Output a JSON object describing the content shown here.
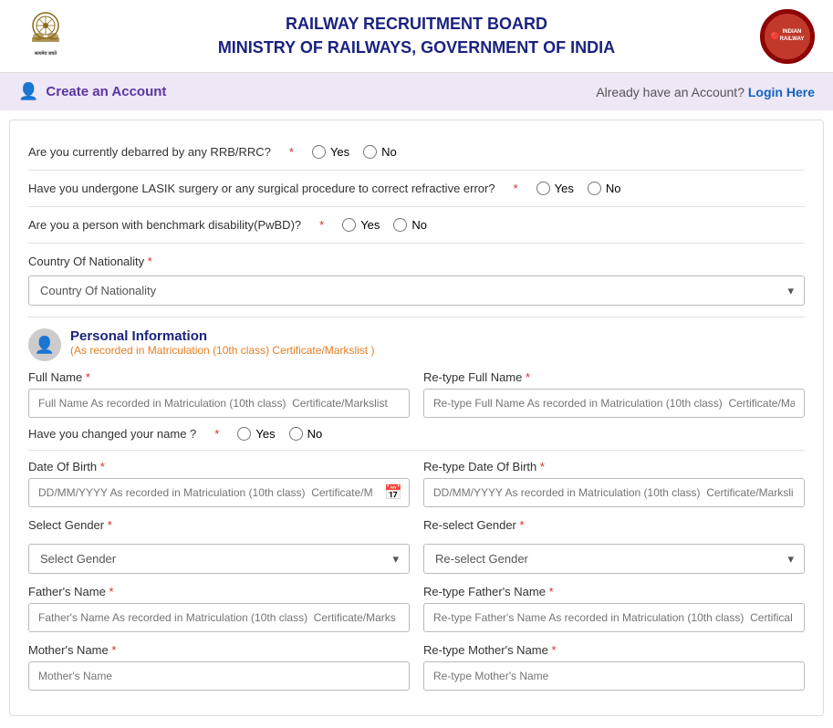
{
  "header": {
    "title_line1": "RAILWAY RECRUITMENT BOARD",
    "title_line2": "MINISTRY OF RAILWAYS, GOVERNMENT OF INDIA",
    "rrb_logo_text": "INDIAN\nRAILWAY"
  },
  "account_bar": {
    "create_account_label": "Create an Account",
    "already_have_label": "Already have an Account?",
    "login_label": "Login Here"
  },
  "form": {
    "debarred_label": "Are you currently debarred by any RRB/RRC?",
    "lasik_label": "Have you undergone LASIK surgery or any surgical procedure to correct refractive error?",
    "disability_label": "Are you a person with benchmark disability(PwBD)?",
    "nationality_label": "Country Of Nationality",
    "nationality_placeholder": "Country Of Nationality",
    "yes_label": "Yes",
    "no_label": "No",
    "required_marker": "*",
    "personal_info": {
      "title": "Personal Information",
      "subtitle": "(As recorded in Matriculation (10th class) Certificate/Markslist )",
      "full_name_label": "Full Name",
      "full_name_placeholder": "Full Name As recorded in Matriculation (10th class)  Certificate/Markslist",
      "retype_full_name_label": "Re-type Full Name",
      "retype_full_name_placeholder": "Re-type Full Name As recorded in Matriculation (10th class)  Certificate/Ma",
      "changed_name_label": "Have you changed your name ?",
      "dob_label": "Date Of Birth",
      "dob_placeholder": "DD/MM/YYYY As recorded in Matriculation (10th class)  Certificate/M",
      "retype_dob_label": "Re-type Date Of Birth",
      "retype_dob_placeholder": "DD/MM/YYYY As recorded in Matriculation (10th class)  Certificate/Marksli",
      "select_gender_label": "Select Gender",
      "select_gender_placeholder": "Select Gender",
      "reselect_gender_label": "Re-select Gender",
      "reselect_gender_placeholder": "Re-select Gender",
      "fathers_name_label": "Father's Name",
      "fathers_name_placeholder": "Father's Name As recorded in Matriculation (10th class)  Certificate/Marks",
      "retype_fathers_name_label": "Re-type Father's Name",
      "retype_fathers_name_placeholder": "Re-type Father's Name As recorded in Matriculation (10th class)  Certifical",
      "mothers_name_label": "Mother's Name",
      "mothers_name_placeholder": "Mother's Name",
      "retype_mothers_name_label": "Re-type Mother's Name",
      "retype_mothers_name_placeholder": "Re-type Mother's Name"
    }
  }
}
